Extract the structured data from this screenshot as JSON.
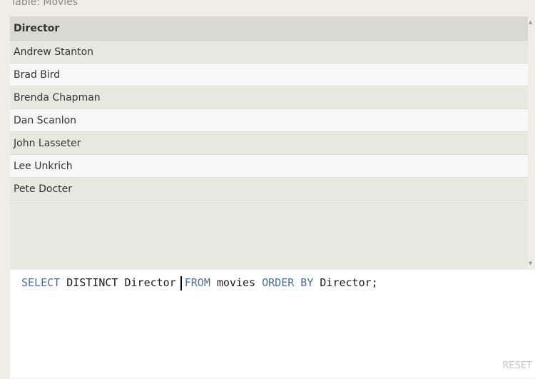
{
  "table": {
    "caption": "Table: Movies"
  },
  "results": {
    "header": "Director",
    "rows": [
      "Andrew Stanton",
      "Brad Bird",
      "Brenda Chapman",
      "Dan Scanlon",
      "John Lasseter",
      "Lee Unkrich",
      "Pete Docter"
    ]
  },
  "query": {
    "kw_select": "SELECT",
    "distinct": "DISTINCT",
    "col": "Director",
    "kw_from": "FROM",
    "table": "movies",
    "kw_order": "ORDER BY",
    "order_col": "Director;"
  },
  "editor": {
    "reset_label": "RESET"
  },
  "colors": {
    "keyword": "#4a6d9e",
    "row_odd": "#e8e8e0",
    "row_even": "#f8f8f6",
    "header": "#d9d9cf"
  }
}
